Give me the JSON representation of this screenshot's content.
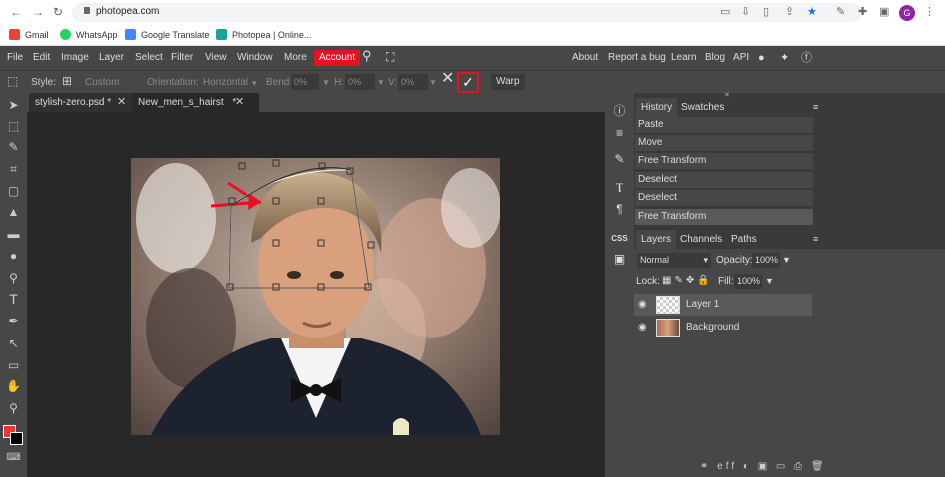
{
  "browser": {
    "url": "photopea.com",
    "avatar_letter": "G",
    "bookmarks": [
      {
        "label": "Gmail",
        "color": "#ea4335"
      },
      {
        "label": "WhatsApp",
        "color": "#25d366"
      },
      {
        "label": "Google Translate",
        "color": "#4285f4"
      },
      {
        "label": "Photopea | Online...",
        "color": "#18a497"
      }
    ]
  },
  "menubar": {
    "items": [
      "File",
      "Edit",
      "Image",
      "Layer",
      "Select",
      "Filter",
      "View",
      "Window",
      "More"
    ],
    "account": "Account",
    "right_items": [
      "About",
      "Report a bug",
      "Learn",
      "Blog",
      "API"
    ]
  },
  "options": {
    "style_label": "Style:",
    "style_value": "Custom",
    "orientation_label": "Orientation:",
    "orientation_value": "Horizontal",
    "bend_label": "Bend:",
    "bend_value": "0%",
    "h_label": "H:",
    "h_value": "0%",
    "v_label": "V:",
    "v_value": "0%",
    "warp_label": "Warp"
  },
  "doc_tabs": [
    {
      "label": "stylish-zero.psd *"
    },
    {
      "label": "New_men_s_hairst"
    },
    {
      "label": "*"
    }
  ],
  "history": {
    "tabs": [
      "History",
      "Swatches"
    ],
    "items": [
      "Paste",
      "Move",
      "Free Transform",
      "Deselect",
      "Deselect",
      "Free Transform"
    ]
  },
  "layers": {
    "tabs": [
      "Layers",
      "Channels",
      "Paths"
    ],
    "blend_mode": "Normal",
    "opacity_label": "Opacity:",
    "opacity_value": "100%",
    "lock_label": "Lock:",
    "fill_label": "Fill:",
    "fill_value": "100%",
    "items": [
      {
        "name": "Layer 1",
        "selected": true
      },
      {
        "name": "Background",
        "selected": false
      }
    ]
  },
  "right_strip_css": "CSS",
  "colors": {
    "foreground": "#e53935",
    "background": "#000000",
    "accent": "#e81123"
  }
}
